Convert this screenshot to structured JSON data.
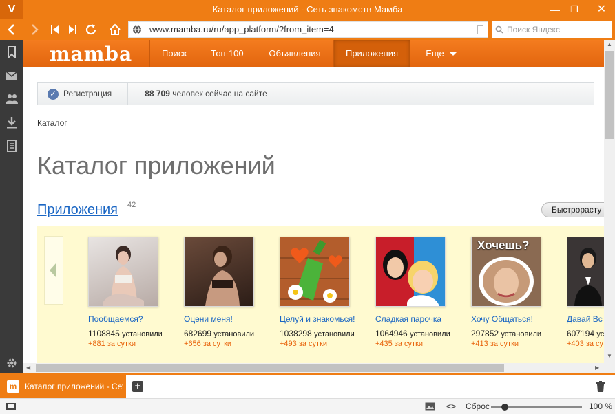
{
  "browser": {
    "logo": "V",
    "title": "Каталог приложений - Сеть знакомств Мамба",
    "url": "www.mamba.ru/ru/app_platform/?from_item=4",
    "search_placeholder": "Поиск Яндекс",
    "accent": "#ef7d14"
  },
  "site": {
    "logo": "mamba",
    "menu": [
      "Поиск",
      "Топ-100",
      "Объявления",
      "Приложения",
      "Еще"
    ],
    "active_menu": "Приложения",
    "register_label": "Регистрация",
    "online_count": "88 709",
    "online_text": "человек сейчас на сайте",
    "breadcrumb": "Каталог",
    "page_title": "Каталог приложений",
    "section_link": "Приложения",
    "section_count": "42",
    "sort_label": "Быстрорасту"
  },
  "apps": [
    {
      "name": "Пообщаемся?",
      "installs": "1108845",
      "installs_word": "установили",
      "per_day": "+881 за сутки"
    },
    {
      "name": "Оцени меня!",
      "installs": "682699",
      "installs_word": "установили",
      "per_day": "+656 за сутки"
    },
    {
      "name": "Целуй и знакомься!",
      "installs": "1038298",
      "installs_word": "установили",
      "per_day": "+493 за сутки"
    },
    {
      "name": "Сладкая парочка",
      "installs": "1064946",
      "installs_word": "установили",
      "per_day": "+435 за сутки"
    },
    {
      "name": "Хочу Общаться!",
      "installs": "297852",
      "installs_word": "установили",
      "per_day": "+413 за сутки",
      "thumb_text": "Хочешь?"
    },
    {
      "name": "Давай Вс",
      "installs": "607194",
      "installs_word": "уст",
      "per_day": "+403 за су"
    }
  ],
  "tabs": [
    {
      "title": "Каталог приложений - Сет",
      "icon": "m"
    }
  ],
  "status": {
    "reset_label": "Сброс",
    "zoom": "100 %"
  }
}
